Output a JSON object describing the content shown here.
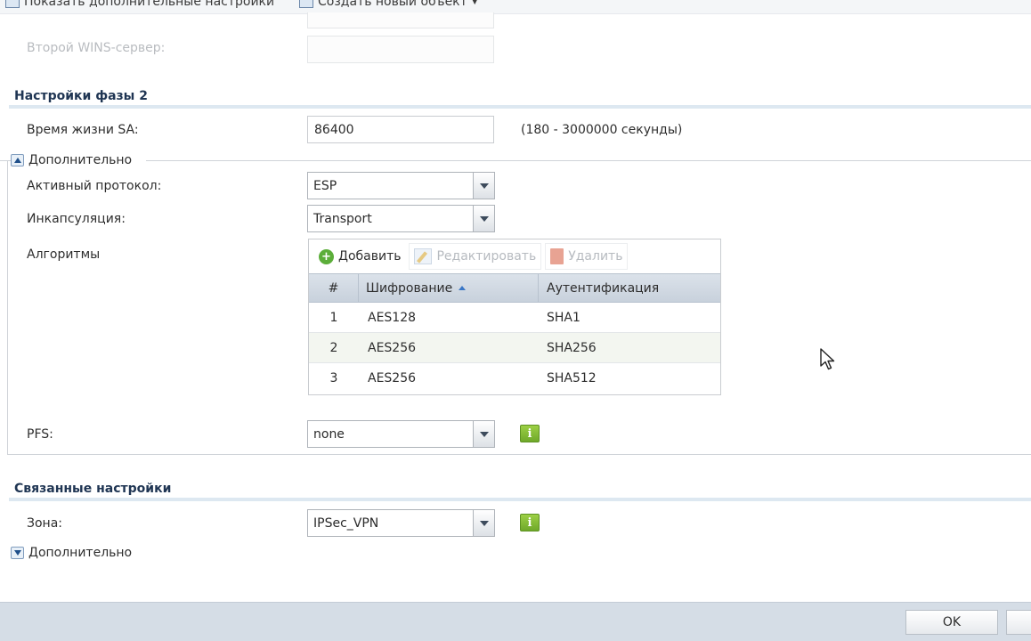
{
  "toolbar": {
    "show_advanced_label": "Показать дополнительные настройки",
    "create_object_label": "Создать новый объект"
  },
  "phase1_tail": {
    "second_wins_label": "Второй WINS-сервер:",
    "second_wins_value": ""
  },
  "phase2": {
    "title": "Настройки фазы 2",
    "sa_lifetime_label": "Время жизни SA:",
    "sa_lifetime_value": "86400",
    "sa_lifetime_hint": "(180 - 3000000 секунды)",
    "advanced_label": "Дополнительно",
    "protocol_label": "Активный протокол:",
    "protocol_value": "ESP",
    "encapsulation_label": "Инкапсуляция:",
    "encapsulation_value": "Transport",
    "algorithms_label": "Алгоритмы",
    "algorithms": {
      "add_label": "Добавить",
      "edit_label": "Редактировать",
      "delete_label": "Удалить",
      "columns": [
        "#",
        "Шифрование",
        "Аутентификация"
      ],
      "rows": [
        {
          "num": "1",
          "encryption": "AES128",
          "authentication": "SHA1"
        },
        {
          "num": "2",
          "encryption": "AES256",
          "authentication": "SHA256"
        },
        {
          "num": "3",
          "encryption": "AES256",
          "authentication": "SHA512"
        }
      ]
    },
    "pfs_label": "PFS:",
    "pfs_value": "none",
    "info_glyph": "i"
  },
  "related": {
    "title": "Связанные настройки",
    "zone_label": "Зона:",
    "zone_value": "IPSec_VPN",
    "info_glyph": "i",
    "advanced_label": "Дополнительно"
  },
  "footer": {
    "ok_label": "OK"
  },
  "icons": {
    "toolbar_show": "list-icon",
    "toolbar_create": "new-object-icon",
    "add": "plus-circle-icon",
    "edit": "edit-icon",
    "delete": "trash-icon",
    "info": "info-icon",
    "collapse": "triangle-up-icon",
    "expand": "triangle-down-icon"
  },
  "colors": {
    "section_title": "#1f3553",
    "section_rule": "#dde8f1",
    "info_green": "#7ab733",
    "footer_bg": "#d5dde6"
  }
}
